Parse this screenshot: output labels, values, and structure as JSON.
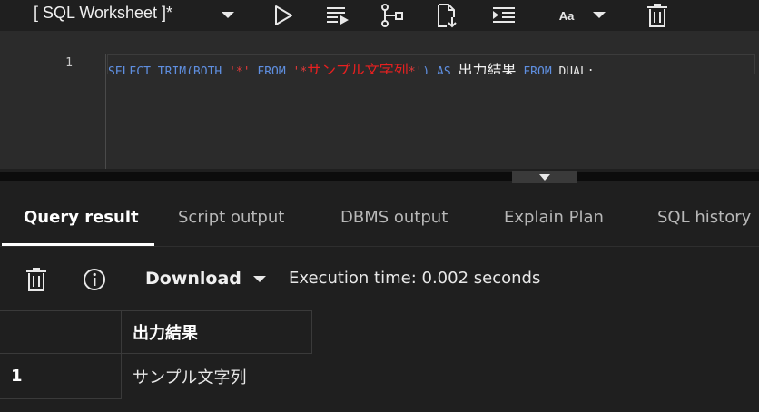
{
  "toolbar": {
    "worksheet_title": "[ SQL Worksheet ]*",
    "icons": [
      "chevron-down-icon",
      "run-icon",
      "run-script-icon",
      "explain-plan-icon",
      "autotrace-icon",
      "format-icon",
      "font-size-icon",
      "delete-icon"
    ],
    "font_size_label": "Aa"
  },
  "editor": {
    "line_number": "1",
    "code_tokens": [
      {
        "text": "SELECT TRIM(BOTH ",
        "kind": "kw"
      },
      {
        "text": "'*'",
        "kind": "str"
      },
      {
        "text": " FROM ",
        "kind": "kw"
      },
      {
        "text": "'*",
        "kind": "str"
      },
      {
        "text": "サンプル文字列",
        "kind": "jp-str"
      },
      {
        "text": "*'",
        "kind": "str"
      },
      {
        "text": ")",
        "kind": "kw"
      },
      {
        "text": " AS ",
        "kind": "kw"
      },
      {
        "text": "出力結果",
        "kind": "jp-plain"
      },
      {
        "text": " FROM ",
        "kind": "kw"
      },
      {
        "text": "DUAL;",
        "kind": "plain"
      }
    ]
  },
  "tabs": {
    "query_result": "Query result",
    "script_output": "Script output",
    "dbms_output": "DBMS output",
    "explain_plan": "Explain Plan",
    "sql_history": "SQL history"
  },
  "result_toolbar": {
    "download_label": "Download",
    "execution_time": "Execution time: 0.002 seconds"
  },
  "result_grid": {
    "columns": [
      "出力結果"
    ],
    "rows": [
      {
        "num": "1",
        "cells": [
          "サンプル文字列"
        ]
      }
    ]
  },
  "colors": {
    "background": "#1f1f1f",
    "editor_background": "#2b2b2b",
    "keyword": "#5f8fe0",
    "string": "#e03a3a",
    "text": "#e8e8e8"
  }
}
